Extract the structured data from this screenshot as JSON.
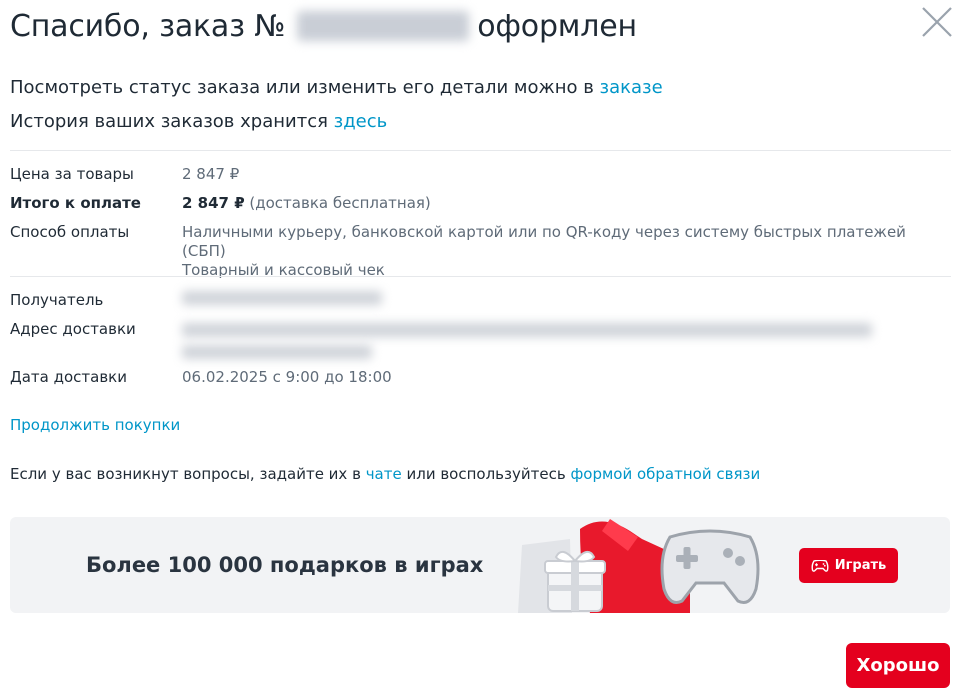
{
  "header": {
    "title_prefix": "Спасибо, заказ №",
    "title_suffix": "оформлен"
  },
  "info": {
    "line1_text": "Посмотреть статус заказа или изменить его детали можно в ",
    "line1_link": "заказе",
    "line2_text": "История ваших заказов хранится ",
    "line2_link": "здесь"
  },
  "summary": {
    "price_label": "Цена за товары",
    "price_value": "2 847 ₽",
    "total_label": "Итого к оплате",
    "total_value": "2 847 ₽",
    "total_note": " (доставка бесплатная)",
    "payment_label": "Способ оплаты",
    "payment_value": "Наличными курьеру, банковской картой или по QR-коду через систему быстрых платежей (СБП)",
    "receipt_value": "Товарный и кассовый чек"
  },
  "delivery": {
    "recipient_label": "Получатель",
    "address_label": "Адрес доставки",
    "date_label": "Дата доставки",
    "date_value": "06.02.2025 с 9:00 до 18:00"
  },
  "continue_link": "Продолжить покупки",
  "questions": {
    "text_before": "Если у вас возникнут вопросы, задайте их в ",
    "chat_link": "чате",
    "text_middle": " или воспользуйтесь ",
    "feedback_link": "формой обратной связи"
  },
  "banner": {
    "text": "Более 100 000 подарков в играх",
    "button_label": "Играть"
  },
  "ok_button": "Хорошо",
  "colors": {
    "accent_red": "#e4001e",
    "link_blue": "#0096c8",
    "text_dark": "#1f2a35",
    "text_muted": "#5f6b78"
  },
  "icons": {
    "close": "close-icon",
    "gamepad": "gamepad-icon"
  }
}
